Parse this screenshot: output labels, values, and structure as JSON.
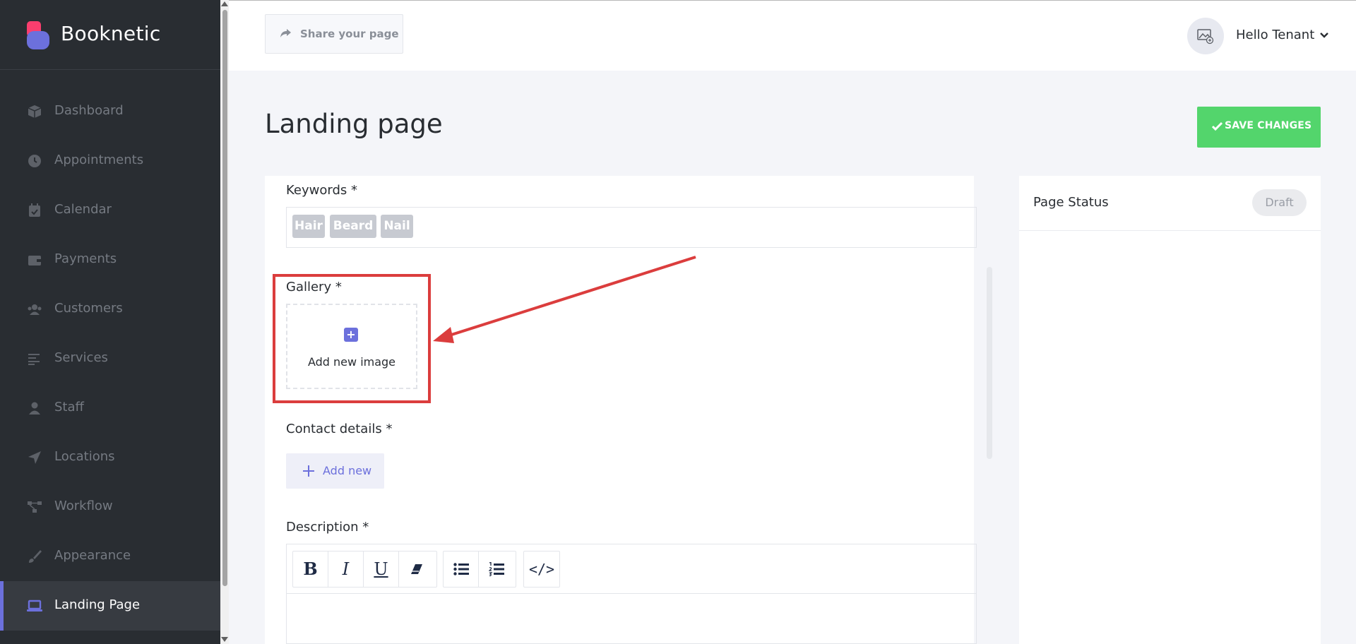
{
  "sidebar": {
    "brand": "Booknetic",
    "items": [
      {
        "label": "Dashboard",
        "icon": "cube-icon"
      },
      {
        "label": "Appointments",
        "icon": "clock-icon"
      },
      {
        "label": "Calendar",
        "icon": "calendar-check-icon"
      },
      {
        "label": "Payments",
        "icon": "wallet-icon"
      },
      {
        "label": "Customers",
        "icon": "users-icon"
      },
      {
        "label": "Services",
        "icon": "align-left-icon"
      },
      {
        "label": "Staff",
        "icon": "user-icon"
      },
      {
        "label": "Locations",
        "icon": "location-arrow-icon"
      },
      {
        "label": "Workflow",
        "icon": "workflow-icon"
      },
      {
        "label": "Appearance",
        "icon": "brush-icon"
      },
      {
        "label": "Landing Page",
        "icon": "laptop-icon",
        "active": true
      }
    ]
  },
  "header": {
    "share_label": "Share your page",
    "user_name": "Hello Tenant"
  },
  "page": {
    "title": "Landing page",
    "save_label": "SAVE CHANGES"
  },
  "form": {
    "keywords_label": "Keywords *",
    "keywords": [
      "Hair",
      "Beard",
      "Nail"
    ],
    "gallery_label": "Gallery *",
    "gallery_add_label": "Add new image",
    "contact_label": "Contact details *",
    "contact_add_label": "Add new",
    "description_label": "Description *",
    "editor_tools": [
      "B",
      "I",
      "U",
      "eraser",
      "ul",
      "ol",
      "</>"
    ]
  },
  "status": {
    "label": "Page Status",
    "value": "Draft"
  },
  "colors": {
    "sidebar_bg": "#292d32",
    "accent": "#6c70dc",
    "save_green": "#53d56c",
    "highlight_red": "#db3d3d"
  }
}
